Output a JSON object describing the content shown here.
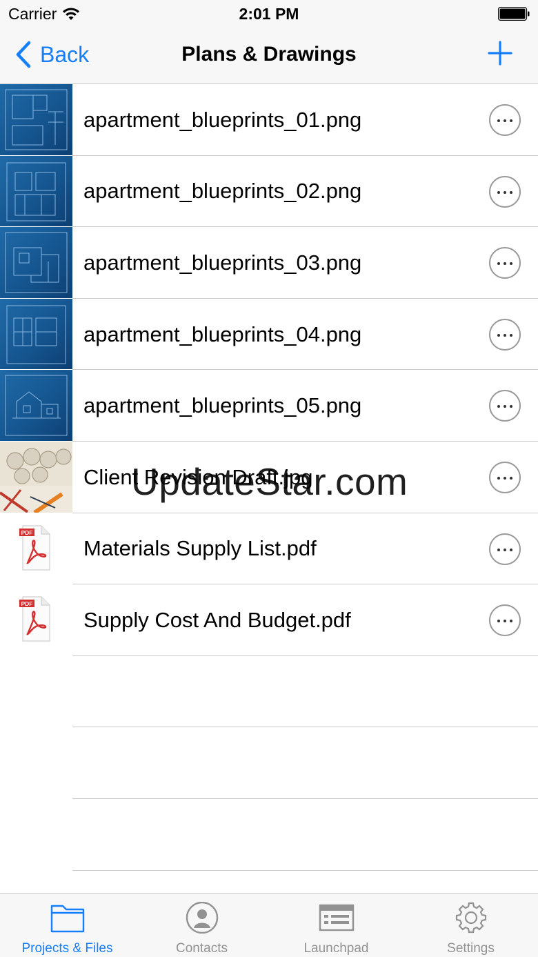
{
  "status_bar": {
    "carrier": "Carrier",
    "time": "2:01 PM"
  },
  "nav": {
    "back_label": "Back",
    "title": "Plans & Drawings"
  },
  "files": [
    {
      "name": "apartment_blueprints_01.png",
      "thumb": "blueprint"
    },
    {
      "name": "apartment_blueprints_02.png",
      "thumb": "blueprint"
    },
    {
      "name": "apartment_blueprints_03.png",
      "thumb": "blueprint"
    },
    {
      "name": "apartment_blueprints_04.png",
      "thumb": "blueprint"
    },
    {
      "name": "apartment_blueprints_05.png",
      "thumb": "blueprint"
    },
    {
      "name": "Client Revision Draft.jpg",
      "thumb": "photo"
    },
    {
      "name": "Materials Supply List.pdf",
      "thumb": "pdf"
    },
    {
      "name": "Supply Cost And Budget.pdf",
      "thumb": "pdf"
    }
  ],
  "watermark": "UpdateStar.com",
  "pdf_badge": "PDF",
  "tabs": [
    {
      "label": "Projects & Files",
      "icon": "folder-icon",
      "active": true
    },
    {
      "label": "Contacts",
      "icon": "contact-icon",
      "active": false
    },
    {
      "label": "Launchpad",
      "icon": "launchpad-icon",
      "active": false
    },
    {
      "label": "Settings",
      "icon": "gear-icon",
      "active": false
    }
  ],
  "colors": {
    "accent": "#147efb",
    "inactive": "#929292",
    "separator": "#c8c7cc",
    "bar_bg": "#f7f7f7"
  }
}
